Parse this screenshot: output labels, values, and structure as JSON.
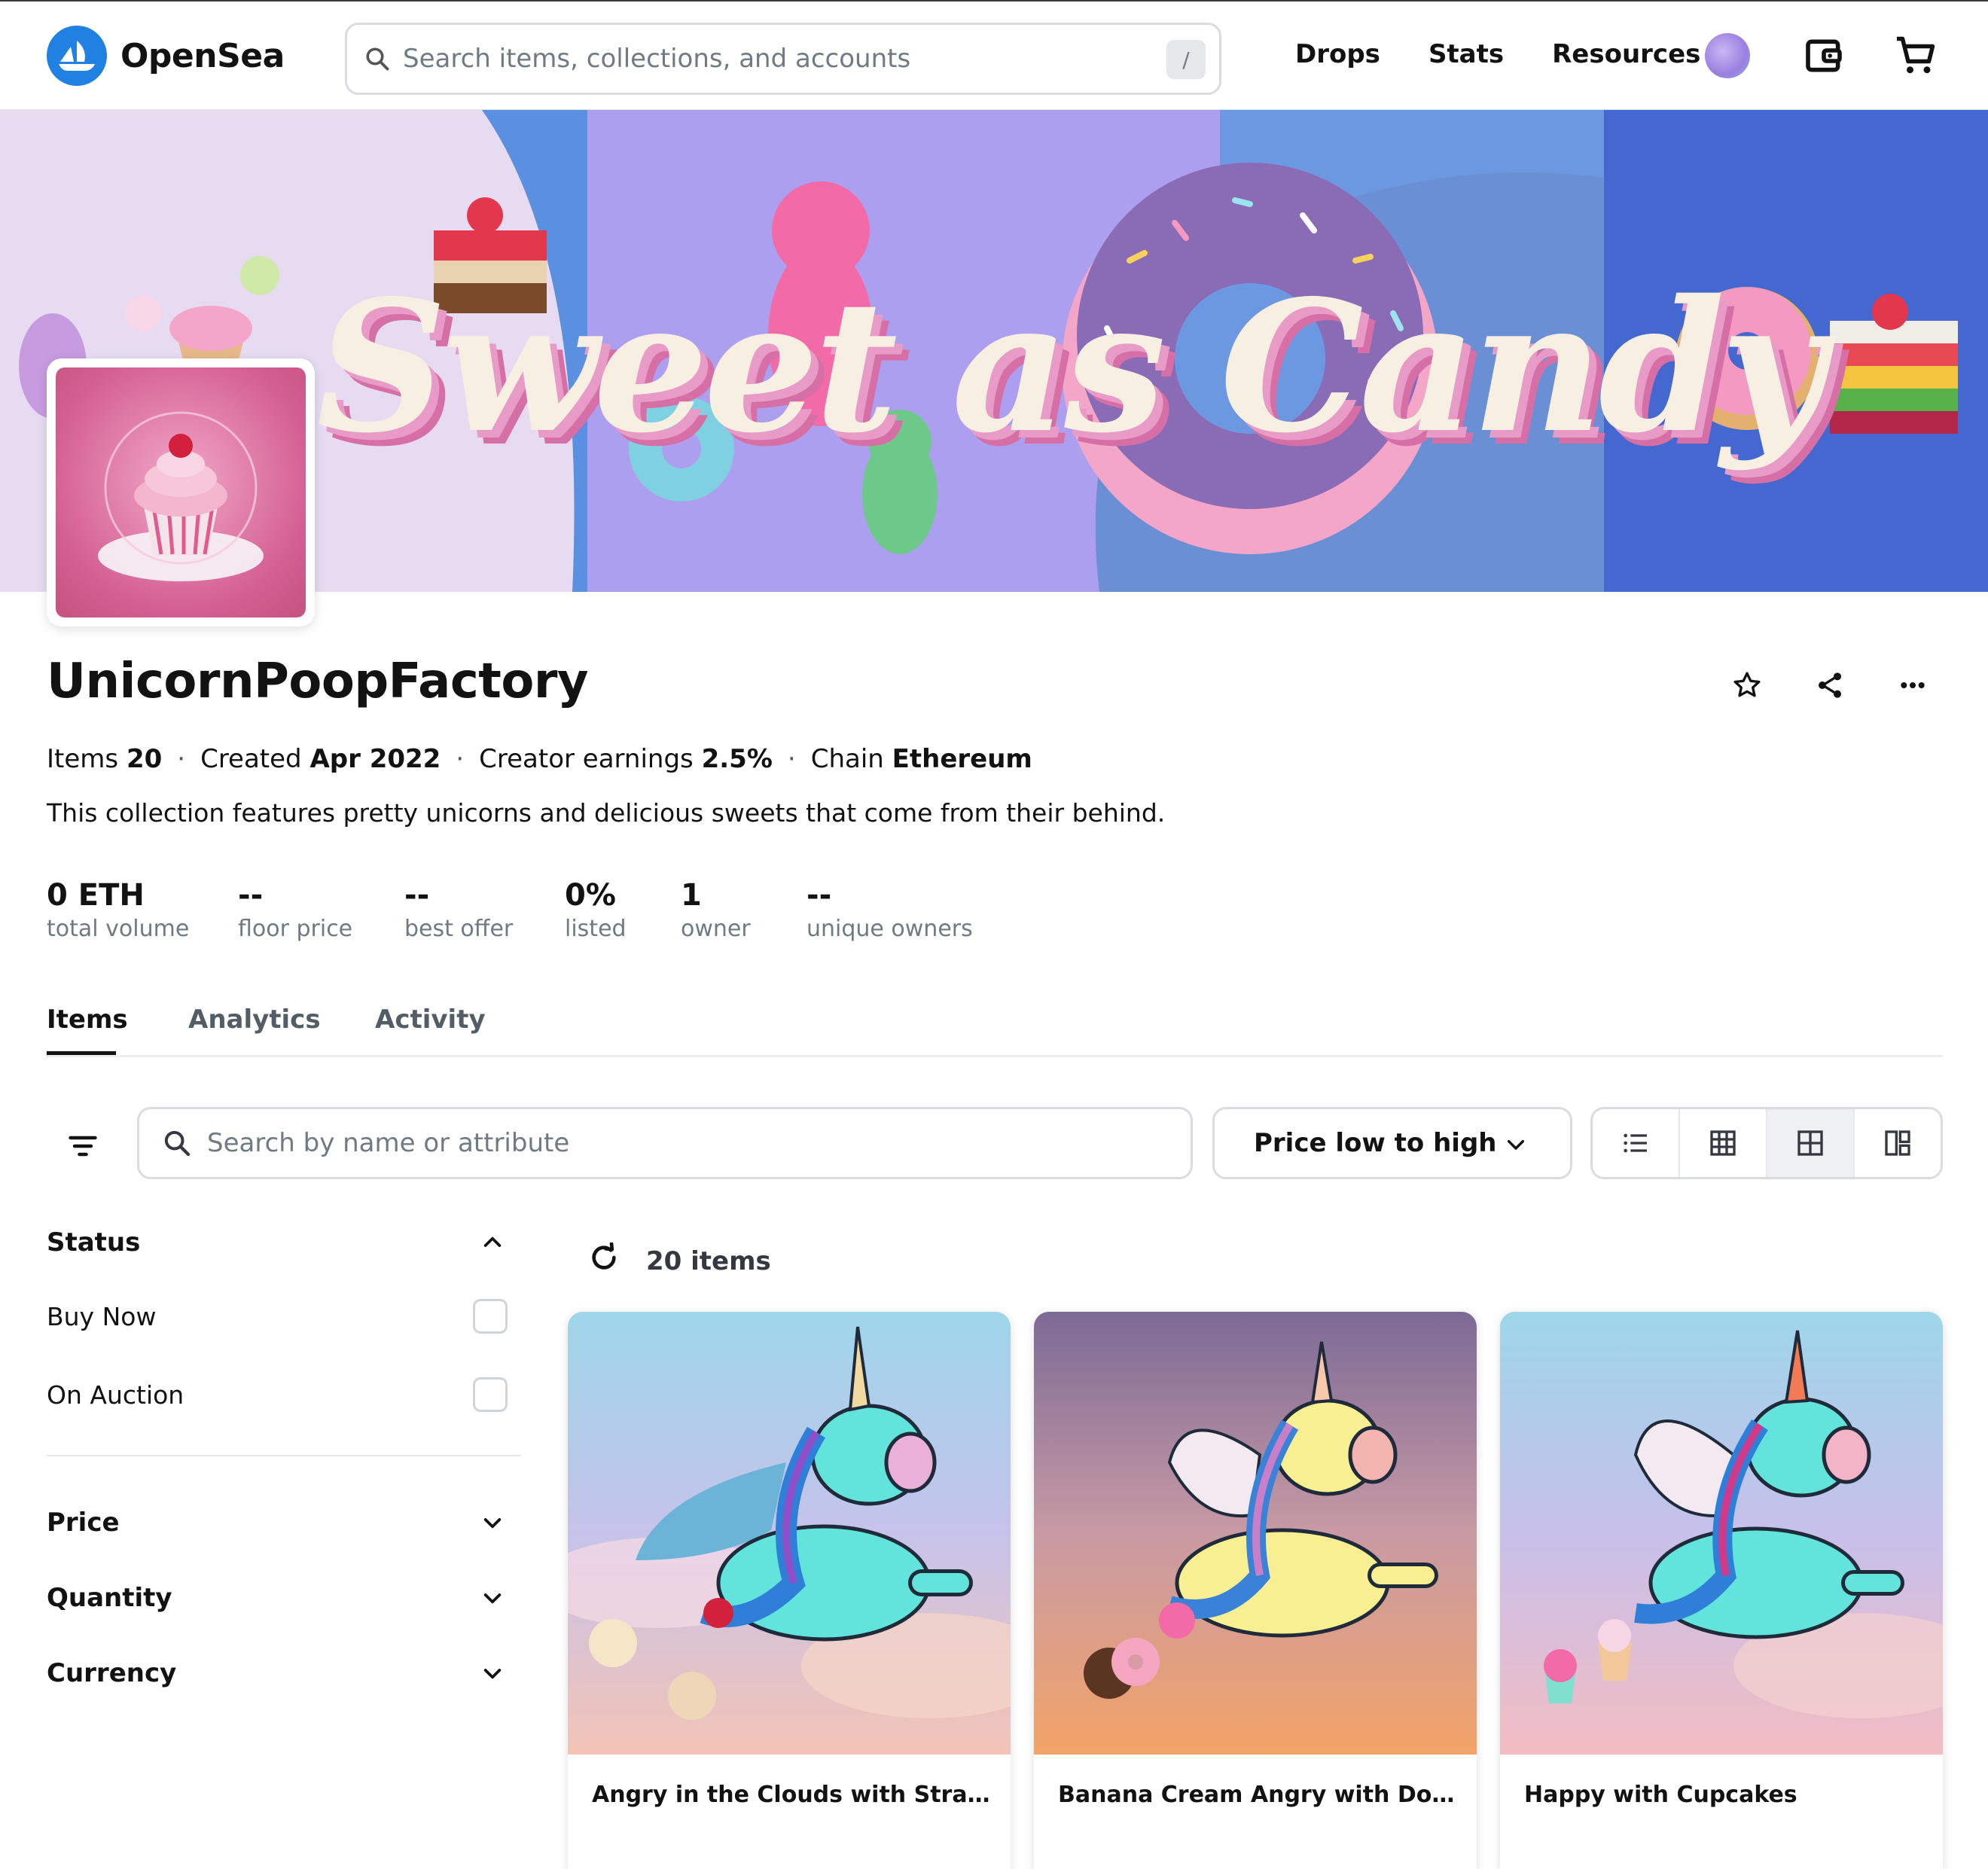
{
  "header": {
    "brand": "OpenSea",
    "search_placeholder": "Search items, collections, and accounts",
    "search_shortcut": "/",
    "nav": [
      "Drops",
      "Stats",
      "Resources"
    ]
  },
  "banner": {
    "text": "Sweet as Candy"
  },
  "collection": {
    "name": "UnicornPoopFactory",
    "meta": {
      "items_label": "Items",
      "items_value": "20",
      "created_label": "Created",
      "created_value": "Apr 2022",
      "earnings_label": "Creator earnings",
      "earnings_value": "2.5%",
      "chain_label": "Chain",
      "chain_value": "Ethereum",
      "separator": "·"
    },
    "description": "This collection features pretty unicorns and delicious sweets that come from their behind.",
    "stats": [
      {
        "value": "0 ETH",
        "label": "total volume"
      },
      {
        "value": "--",
        "label": "floor price"
      },
      {
        "value": "--",
        "label": "best offer"
      },
      {
        "value": "0%",
        "label": "listed"
      },
      {
        "value": "1",
        "label": "owner"
      },
      {
        "value": "--",
        "label": "unique owners"
      }
    ]
  },
  "tabs": [
    "Items",
    "Analytics",
    "Activity"
  ],
  "toolbar": {
    "search_placeholder": "Search by name or attribute",
    "sort_value": "Price low to high"
  },
  "sidebar": {
    "status_title": "Status",
    "status_options": [
      "Buy Now",
      "On Auction"
    ],
    "sections": [
      "Price",
      "Quantity",
      "Currency"
    ]
  },
  "results": {
    "count_label": "20 items"
  },
  "items": [
    {
      "title": "Angry in the Clouds with Strawberri..."
    },
    {
      "title": "Banana Cream Angry with Donuts"
    },
    {
      "title": "Happy with Cupcakes"
    }
  ],
  "colors": {
    "brand_blue": "#2081e2",
    "border": "#d9dce0",
    "muted_text": "#707a83"
  }
}
